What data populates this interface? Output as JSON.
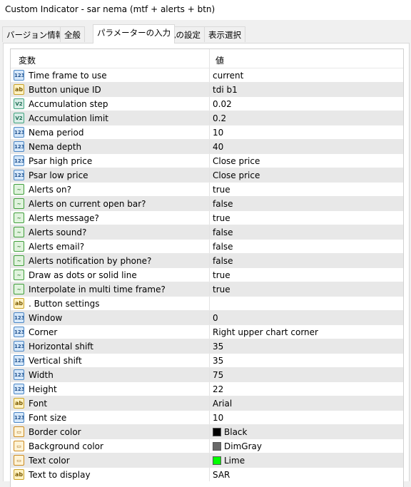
{
  "window": {
    "title": "Custom Indicator - sar nema (mtf + alerts + btn)"
  },
  "tabs": [
    "バージョン情報",
    "全般",
    "パラメーターの入力",
    "色の設定",
    "表示選択"
  ],
  "active_tab": "パラメーターの入力",
  "table": {
    "headers": {
      "variable": "変数",
      "value": "値"
    },
    "rows": [
      {
        "type": "num",
        "icon": "integer-icon",
        "name": "Time frame to use",
        "value": "current"
      },
      {
        "type": "str",
        "icon": "string-icon",
        "name": "Button unique ID",
        "value": "tdi b1"
      },
      {
        "type": "dbl",
        "icon": "double-icon",
        "name": "Accumulation step",
        "value": "0.02"
      },
      {
        "type": "dbl",
        "icon": "double-icon",
        "name": "Accumulation limit",
        "value": "0.2"
      },
      {
        "type": "num",
        "icon": "integer-icon",
        "name": "Nema period",
        "value": "10"
      },
      {
        "type": "num",
        "icon": "integer-icon",
        "name": "Nema depth",
        "value": "40"
      },
      {
        "type": "num",
        "icon": "integer-icon",
        "name": "Psar high price",
        "value": "Close price"
      },
      {
        "type": "num",
        "icon": "integer-icon",
        "name": "Psar low price",
        "value": "Close price"
      },
      {
        "type": "bool",
        "icon": "boolean-icon",
        "name": "Alerts on?",
        "value": "true"
      },
      {
        "type": "bool",
        "icon": "boolean-icon",
        "name": "Alerts on current open bar?",
        "value": "false"
      },
      {
        "type": "bool",
        "icon": "boolean-icon",
        "name": "Alerts message?",
        "value": "true"
      },
      {
        "type": "bool",
        "icon": "boolean-icon",
        "name": "Alerts sound?",
        "value": "false"
      },
      {
        "type": "bool",
        "icon": "boolean-icon",
        "name": "Alerts email?",
        "value": "false"
      },
      {
        "type": "bool",
        "icon": "boolean-icon",
        "name": "Alerts notification by phone?",
        "value": "false"
      },
      {
        "type": "bool",
        "icon": "boolean-icon",
        "name": "Draw as dots or solid line",
        "value": "true"
      },
      {
        "type": "bool",
        "icon": "boolean-icon",
        "name": "Interpolate in multi time frame?",
        "value": "true"
      },
      {
        "type": "str",
        "icon": "string-icon",
        "name": ". Button settings",
        "value": ""
      },
      {
        "type": "num",
        "icon": "integer-icon",
        "name": "Window",
        "value": "0"
      },
      {
        "type": "num",
        "icon": "integer-icon",
        "name": "Corner",
        "value": "Right upper chart corner"
      },
      {
        "type": "num",
        "icon": "integer-icon",
        "name": "Horizontal shift",
        "value": "35"
      },
      {
        "type": "num",
        "icon": "integer-icon",
        "name": "Vertical shift",
        "value": "35"
      },
      {
        "type": "num",
        "icon": "integer-icon",
        "name": "Width",
        "value": "75"
      },
      {
        "type": "num",
        "icon": "integer-icon",
        "name": "Height",
        "value": "22"
      },
      {
        "type": "str",
        "icon": "string-icon",
        "name": "Font",
        "value": "Arial"
      },
      {
        "type": "num",
        "icon": "integer-icon",
        "name": "Font size",
        "value": "10"
      },
      {
        "type": "col",
        "icon": "color-icon",
        "name": "Border color",
        "value": "Black",
        "swatch": "#000000"
      },
      {
        "type": "col",
        "icon": "color-icon",
        "name": "Background color",
        "value": "DimGray",
        "swatch": "#696969"
      },
      {
        "type": "col",
        "icon": "color-icon",
        "name": "Text color",
        "value": "Lime",
        "swatch": "#00ff00"
      },
      {
        "type": "str",
        "icon": "string-icon",
        "name": "Text to display",
        "value": "SAR"
      }
    ]
  },
  "icon_glyphs": {
    "num": "123",
    "dbl": "V2",
    "str": "ab",
    "bool": "~",
    "col": "▭"
  }
}
